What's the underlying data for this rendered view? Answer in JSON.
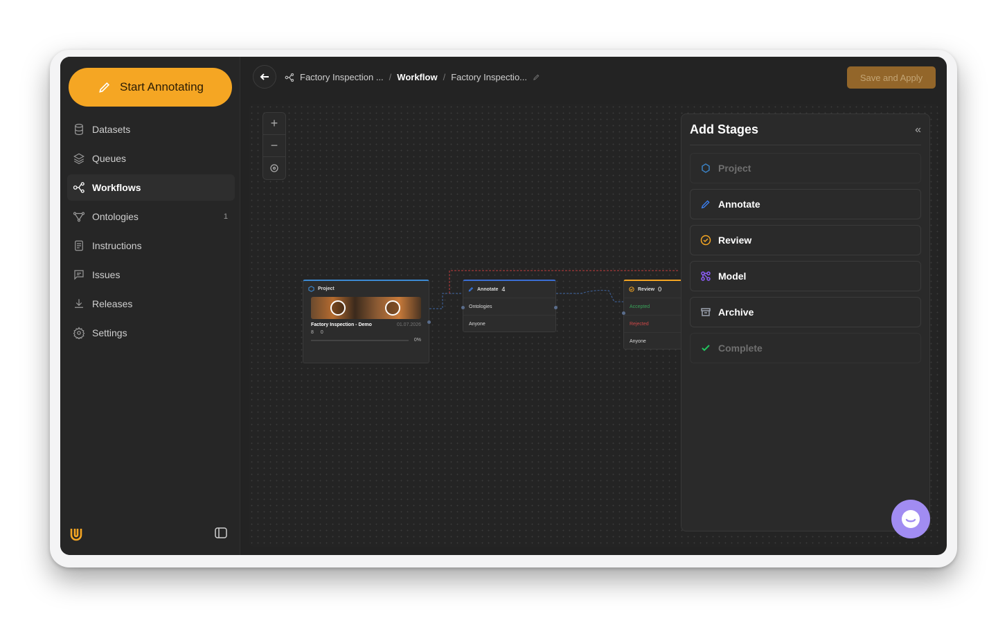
{
  "sidebar": {
    "start_label": "Start Annotating",
    "items": [
      {
        "label": "Datasets",
        "icon": "database-icon"
      },
      {
        "label": "Queues",
        "icon": "layers-icon"
      },
      {
        "label": "Workflows",
        "icon": "workflow-icon",
        "active": true
      },
      {
        "label": "Ontologies",
        "icon": "ontology-icon",
        "count": "1"
      },
      {
        "label": "Instructions",
        "icon": "document-icon"
      },
      {
        "label": "Issues",
        "icon": "message-icon"
      },
      {
        "label": "Releases",
        "icon": "download-icon"
      },
      {
        "label": "Settings",
        "icon": "gear-icon"
      }
    ]
  },
  "topbar": {
    "crumbs": [
      "Factory Inspection ...",
      "Workflow",
      "Factory Inspectio..."
    ],
    "save_label": "Save and Apply"
  },
  "canvas": {
    "project_node": {
      "title": "Project",
      "name": "Factory Inspection - Demo",
      "date": "01.07.2026",
      "datasets": "8",
      "queues": "0",
      "progress": "0%"
    },
    "annotate_node": {
      "title": "Annotate",
      "count": "4",
      "row1": "Ontologies",
      "row2": "Anyone"
    },
    "review_node": {
      "title": "Review",
      "count": "0",
      "row1": "Accepted",
      "row2": "Rejected",
      "row3": "Anyone"
    }
  },
  "panel": {
    "title": "Add Stages",
    "stages": [
      {
        "label": "Project",
        "enabled": false,
        "color": "#3b82c4"
      },
      {
        "label": "Annotate",
        "enabled": true,
        "color": "#3b82f6"
      },
      {
        "label": "Review",
        "enabled": true,
        "color": "#f5a623"
      },
      {
        "label": "Model",
        "enabled": true,
        "color": "#8b5cf6"
      },
      {
        "label": "Archive",
        "enabled": true,
        "color": "#9ca3af"
      },
      {
        "label": "Complete",
        "enabled": false,
        "color": "#22c55e"
      }
    ]
  },
  "colors": {
    "accent": "#f5a623",
    "background": "#232323",
    "chat": "#a18cf2"
  }
}
